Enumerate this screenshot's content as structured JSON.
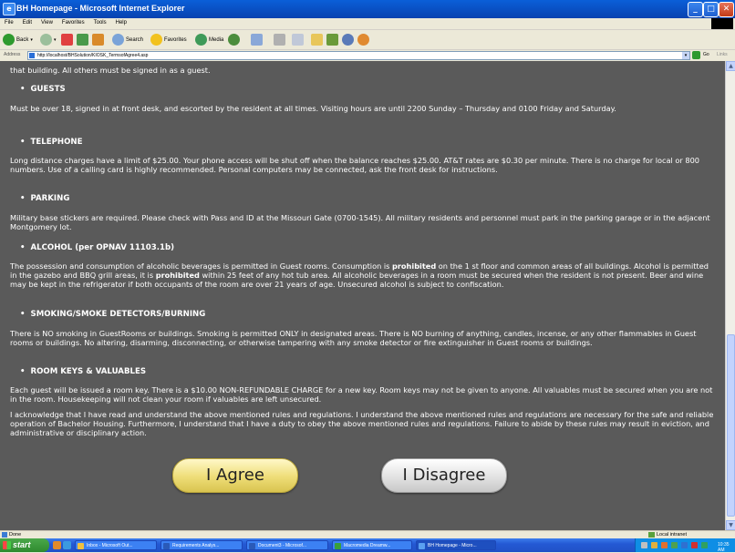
{
  "window": {
    "title": "BH Homepage - Microsoft Internet Explorer"
  },
  "menu": [
    "File",
    "Edit",
    "View",
    "Favorites",
    "Tools",
    "Help"
  ],
  "toolbar": {
    "back": "Back",
    "search": "Search",
    "favorites": "Favorites",
    "media": "Media"
  },
  "address": {
    "label": "Address",
    "url": "http://localhost/BHSolution/KIOSK_TermsofAgree4.asp",
    "go": "Go",
    "links": "Links"
  },
  "content": {
    "top_cut": "that building. All others must be signed in as a guest.",
    "sections": [
      {
        "heading": "GUESTS",
        "body": "Must be over 18, signed in at front desk, and escorted by the resident at all times. Visiting hours are until 2200 Sunday – Thursday and 0100 Friday and Saturday."
      },
      {
        "heading": "TELEPHONE",
        "body": "Long distance charges have a limit of $25.00. Your phone access will be shut off when the balance reaches $25.00. AT&T rates are $0.30 per minute. There is no charge for local or 800 numbers. Use of a calling card is highly recommended. Personal computers may be connected, ask the front desk for instructions."
      },
      {
        "heading": "PARKING",
        "body": "Military base stickers are required. Please check with Pass and ID at the Missouri Gate (0700-1545). All military residents and personnel must park in the parking garage or in the adjacent Montgomery lot."
      },
      {
        "heading": "ALCOHOL (per OPNAV 11103.1b)",
        "body_parts": [
          "The possession and consumption of alcoholic beverages is permitted in Guest rooms. Consumption is ",
          "prohibited",
          " on the 1 st floor and common areas of all buildings. Alcohol is permitted in the gazebo and BBQ grill areas, it is ",
          "prohibited",
          " within 25 feet of any hot tub area. All alcoholic beverages in a room must be secured when the resident is not present. Beer and wine may be kept in the refrigerator if both occupants of the room are over 21 years of age. Unsecured alcohol is subject to confiscation."
        ]
      },
      {
        "heading": "SMOKING/SMOKE DETECTORS/BURNING",
        "body": "There is NO smoking in GuestRooms or buildings. Smoking is permitted ONLY in designated areas. There is NO burning of anything, candles, incense, or any other flammables in Guest rooms or buildings. No altering, disarming, disconnecting, or otherwise tampering with any smoke detector or fire extinguisher in Guest rooms or buildings."
      },
      {
        "heading": "ROOM KEYS & VALUABLES",
        "body": "Each guest will be issued a room key. There is a $10.00 NON-REFUNDABLE CHARGE for a new key. Room keys may not be given to anyone. All valuables must be secured when you are not in the room. Housekeeping will not clean your room if valuables are left unsecured."
      }
    ],
    "acknowledge": "I acknowledge that I have read and understand the above mentioned rules and regulations. I understand the above mentioned rules and regulations are necessary for the safe and reliable operation of Bachelor Housing. Furthermore, I understand that I have a duty to obey the above mentioned rules and regulations. Failure to abide by these rules may result in eviction, and administrative or disciplinary action.",
    "agree_label": "I Agree",
    "disagree_label": "I Disagree"
  },
  "status": {
    "left": "Done",
    "zone": "Local intranet"
  },
  "taskbar": {
    "start": "start",
    "tasks": [
      "Inbox - Microsoft Out...",
      "Requirements Analys...",
      "Document3 - Microsof...",
      "Macromedia Dreamw...",
      "BH Homepage - Micro..."
    ],
    "clock": "10:35 AM"
  },
  "colors": {
    "content_bg": "#5a5a5a",
    "agree_btn": "#eedd77",
    "disagree_btn": "#e2e2e2"
  }
}
